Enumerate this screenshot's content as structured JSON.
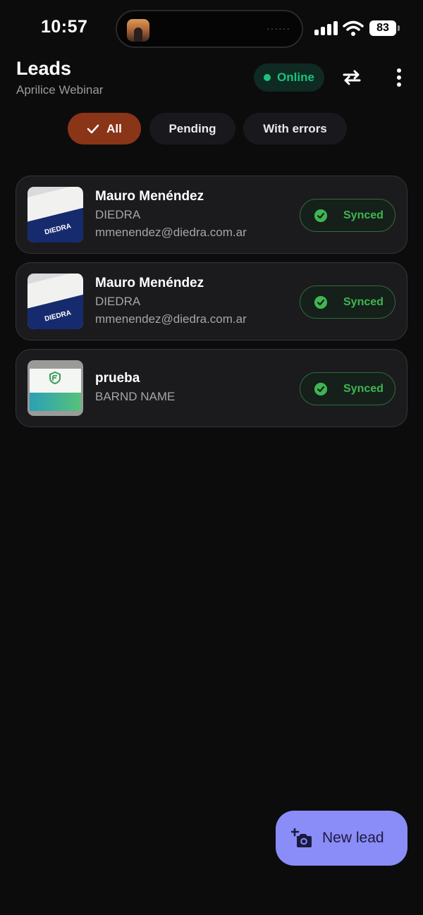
{
  "status_bar": {
    "time": "10:57",
    "battery": "83",
    "island_indicator": "······"
  },
  "header": {
    "title": "Leads",
    "subtitle": "Aprilice Webinar",
    "status_label": "Online",
    "status_color": "#19c37d"
  },
  "filters": [
    {
      "label": "All",
      "active": true
    },
    {
      "label": "Pending",
      "active": false
    },
    {
      "label": "With errors",
      "active": false
    }
  ],
  "leads": [
    {
      "name": "Mauro Menéndez",
      "company": "DIEDRA",
      "email": "mmenendez@diedra.com.ar",
      "status": "Synced",
      "card_text": "DIEDRA"
    },
    {
      "name": "Mauro Menéndez",
      "company": "DIEDRA",
      "email": "mmenendez@diedra.com.ar",
      "status": "Synced",
      "card_text": "DIEDRA"
    },
    {
      "name": "prueba",
      "company": "BARND NAME",
      "email": "",
      "status": "Synced",
      "card_text": ""
    }
  ],
  "fab": {
    "label": "New lead",
    "icon": "add-camera-icon"
  },
  "colors": {
    "accent": "#8a8cf8",
    "active_chip": "#8a3418",
    "synced": "#3fb552"
  }
}
